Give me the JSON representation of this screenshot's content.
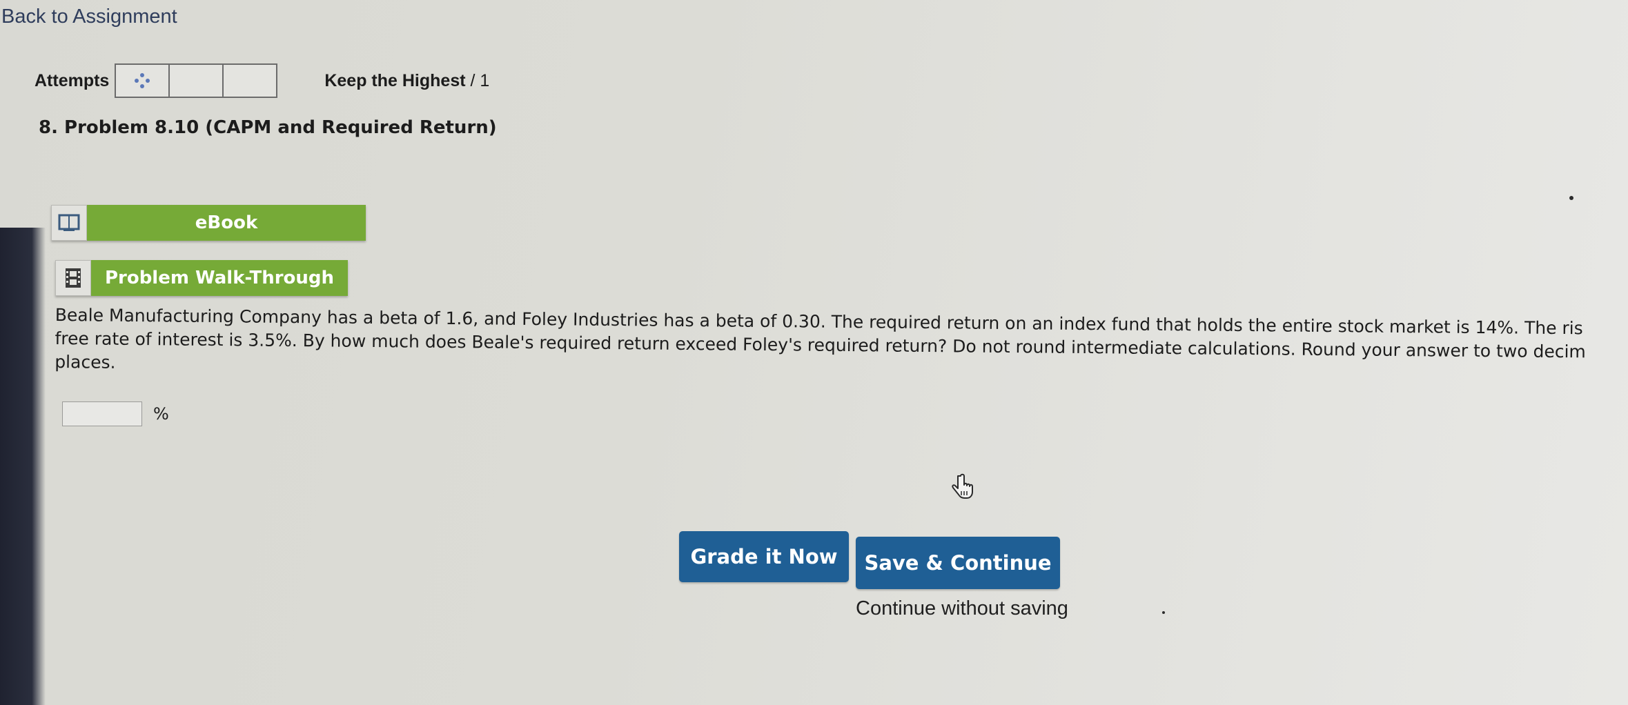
{
  "nav": {
    "back_label": "Back to Assignment"
  },
  "attempts": {
    "label": "Attempts",
    "keep_label": "Keep the Highest",
    "keep_suffix": " / 1",
    "icon": "dots-icon"
  },
  "problem": {
    "title": "8.  Problem 8.10 (CAPM and Required Return)",
    "lines": [
      "Beale Manufacturing Company has a beta of 1.6, and Foley Industries has a beta of 0.30. The required return on an index fund that holds the entire stock market is 14%. The ris",
      "free rate of interest is 3.5%. By how much does Beale's required return exceed Foley's required return? Do not round intermediate calculations. Round your answer to two decim",
      "places."
    ]
  },
  "resources": {
    "ebook_label": "eBook",
    "walkthrough_label": "Problem Walk-Through"
  },
  "answer": {
    "value": "",
    "unit": "%"
  },
  "actions": {
    "grade_label": "Grade it Now",
    "save_label": "Save & Continue",
    "continue_label": "Continue without saving"
  },
  "colors": {
    "primary_button": "#1f5f95",
    "resource_button": "#76aa37",
    "link": "#2f3d5c"
  }
}
